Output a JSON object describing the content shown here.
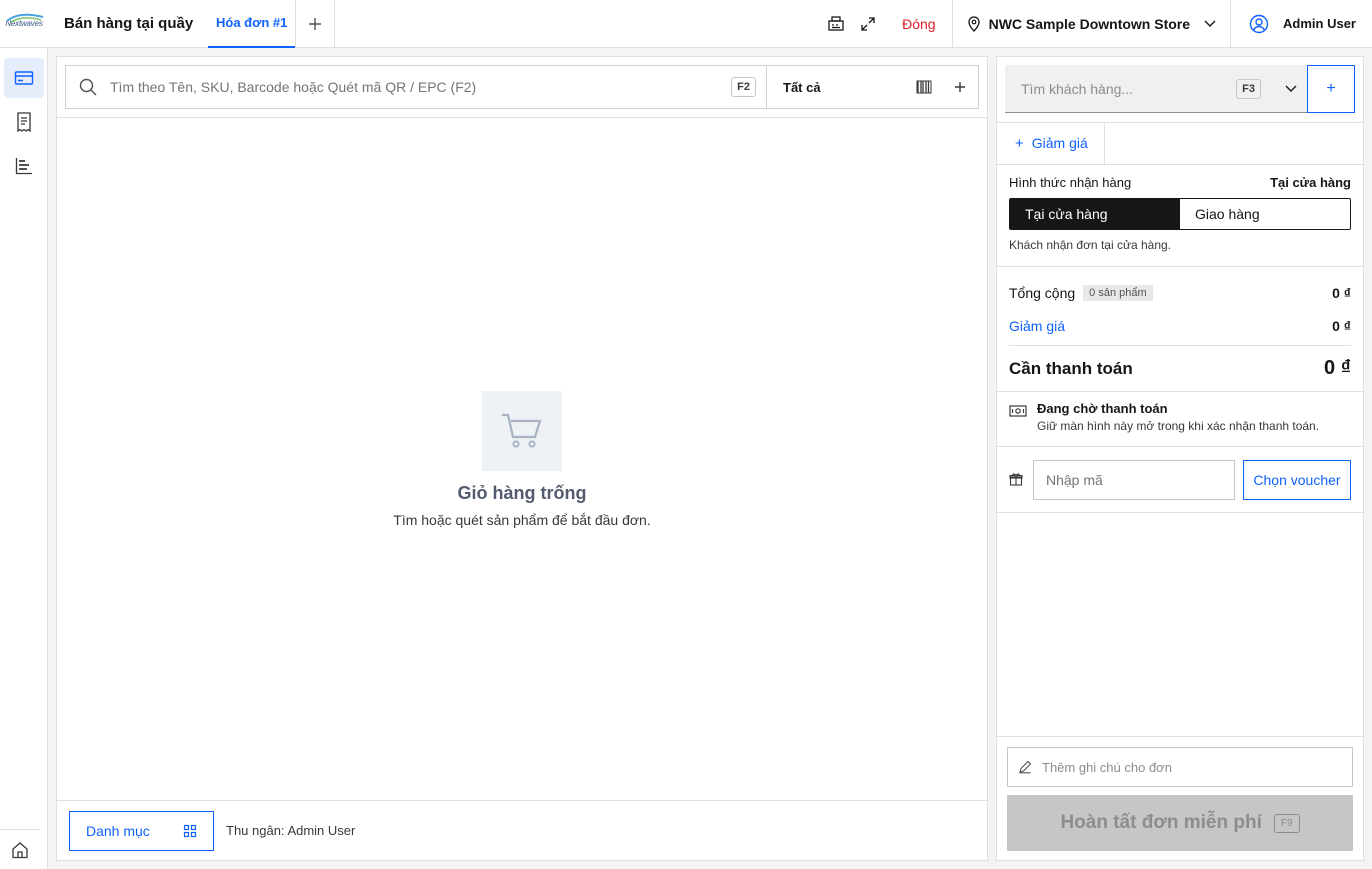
{
  "header": {
    "logo_text": "Nextwaves",
    "app_title": "Bán hàng tại quầy",
    "active_tab": "Hóa đơn #1",
    "close_label": "Đóng",
    "store_name": "NWC Sample Downtown Store",
    "user_name": "Admin User"
  },
  "search": {
    "placeholder": "Tìm theo Tên, SKU, Barcode hoặc Quét mã QR / EPC (F2)",
    "shortcut": "F2",
    "filter_label": "Tất cả"
  },
  "cart": {
    "empty_title": "Giỏ hàng trống",
    "empty_subtitle": "Tìm hoặc quét sản phẩm để bắt đầu đơn."
  },
  "footer": {
    "category_label": "Danh mục",
    "cashier": "Thu ngân: Admin User"
  },
  "customer": {
    "placeholder": "Tìm khách hàng...",
    "shortcut": "F3",
    "add_label": "+"
  },
  "discount": {
    "label": "Giảm giá"
  },
  "receive": {
    "label": "Hình thức nhận hàng",
    "value": "Tại cửa hàng",
    "options": [
      "Tại cửa hàng",
      "Giao hàng"
    ],
    "note": "Khách nhận đơn tại cửa hàng."
  },
  "summary": {
    "total_label": "Tổng cộng",
    "item_count": "0 sản phẩm",
    "total_value": "0 ₫",
    "discount_label": "Giảm giá",
    "discount_value": "0 ₫",
    "due_label": "Cần thanh toán",
    "due_value": "0 ₫"
  },
  "payment": {
    "title": "Đang chờ thanh toán",
    "subtitle": "Giữ màn hình này mở trong khi xác nhận thanh toán."
  },
  "voucher": {
    "placeholder": "Nhập mã",
    "button": "Chọn voucher"
  },
  "note": {
    "placeholder": "Thêm ghi chú cho đơn"
  },
  "finish": {
    "label": "Hoàn tất đơn miễn phí",
    "shortcut": "F9"
  },
  "colors": {
    "accent": "#0f62fe",
    "danger": "#da1e28",
    "dark": "#161616"
  }
}
